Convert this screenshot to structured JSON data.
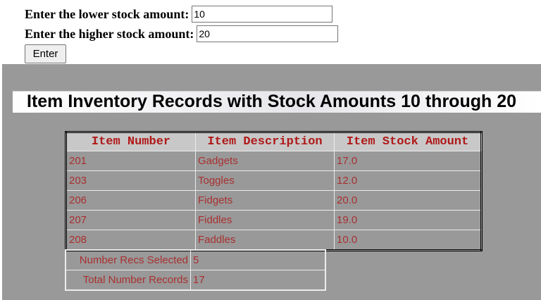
{
  "form": {
    "lower_label": "Enter the lower stock amount:",
    "lower_value": "10",
    "higher_label": "Enter the higher stock amount:",
    "higher_value": "20",
    "enter_label": "Enter"
  },
  "report": {
    "title": "Item Inventory Records with Stock Amounts 10 through 20",
    "columns": [
      "Item Number",
      "Item Description",
      "Item Stock Amount"
    ],
    "rows": [
      {
        "number": "201",
        "description": "Gadgets",
        "stock": "17.0"
      },
      {
        "number": "203",
        "description": "Toggles",
        "stock": "12.0"
      },
      {
        "number": "206",
        "description": "Fidgets",
        "stock": "20.0"
      },
      {
        "number": "207",
        "description": "Fiddles",
        "stock": "19.0"
      },
      {
        "number": "208",
        "description": "Faddles",
        "stock": "10.0"
      }
    ],
    "summary": [
      {
        "label": "Number Recs Selected",
        "value": "5"
      },
      {
        "label": "Total Number Records",
        "value": "17"
      }
    ]
  },
  "colors": {
    "report_background": "#999999",
    "table_text": "#a83030",
    "header_background": "#c8c8c8"
  }
}
